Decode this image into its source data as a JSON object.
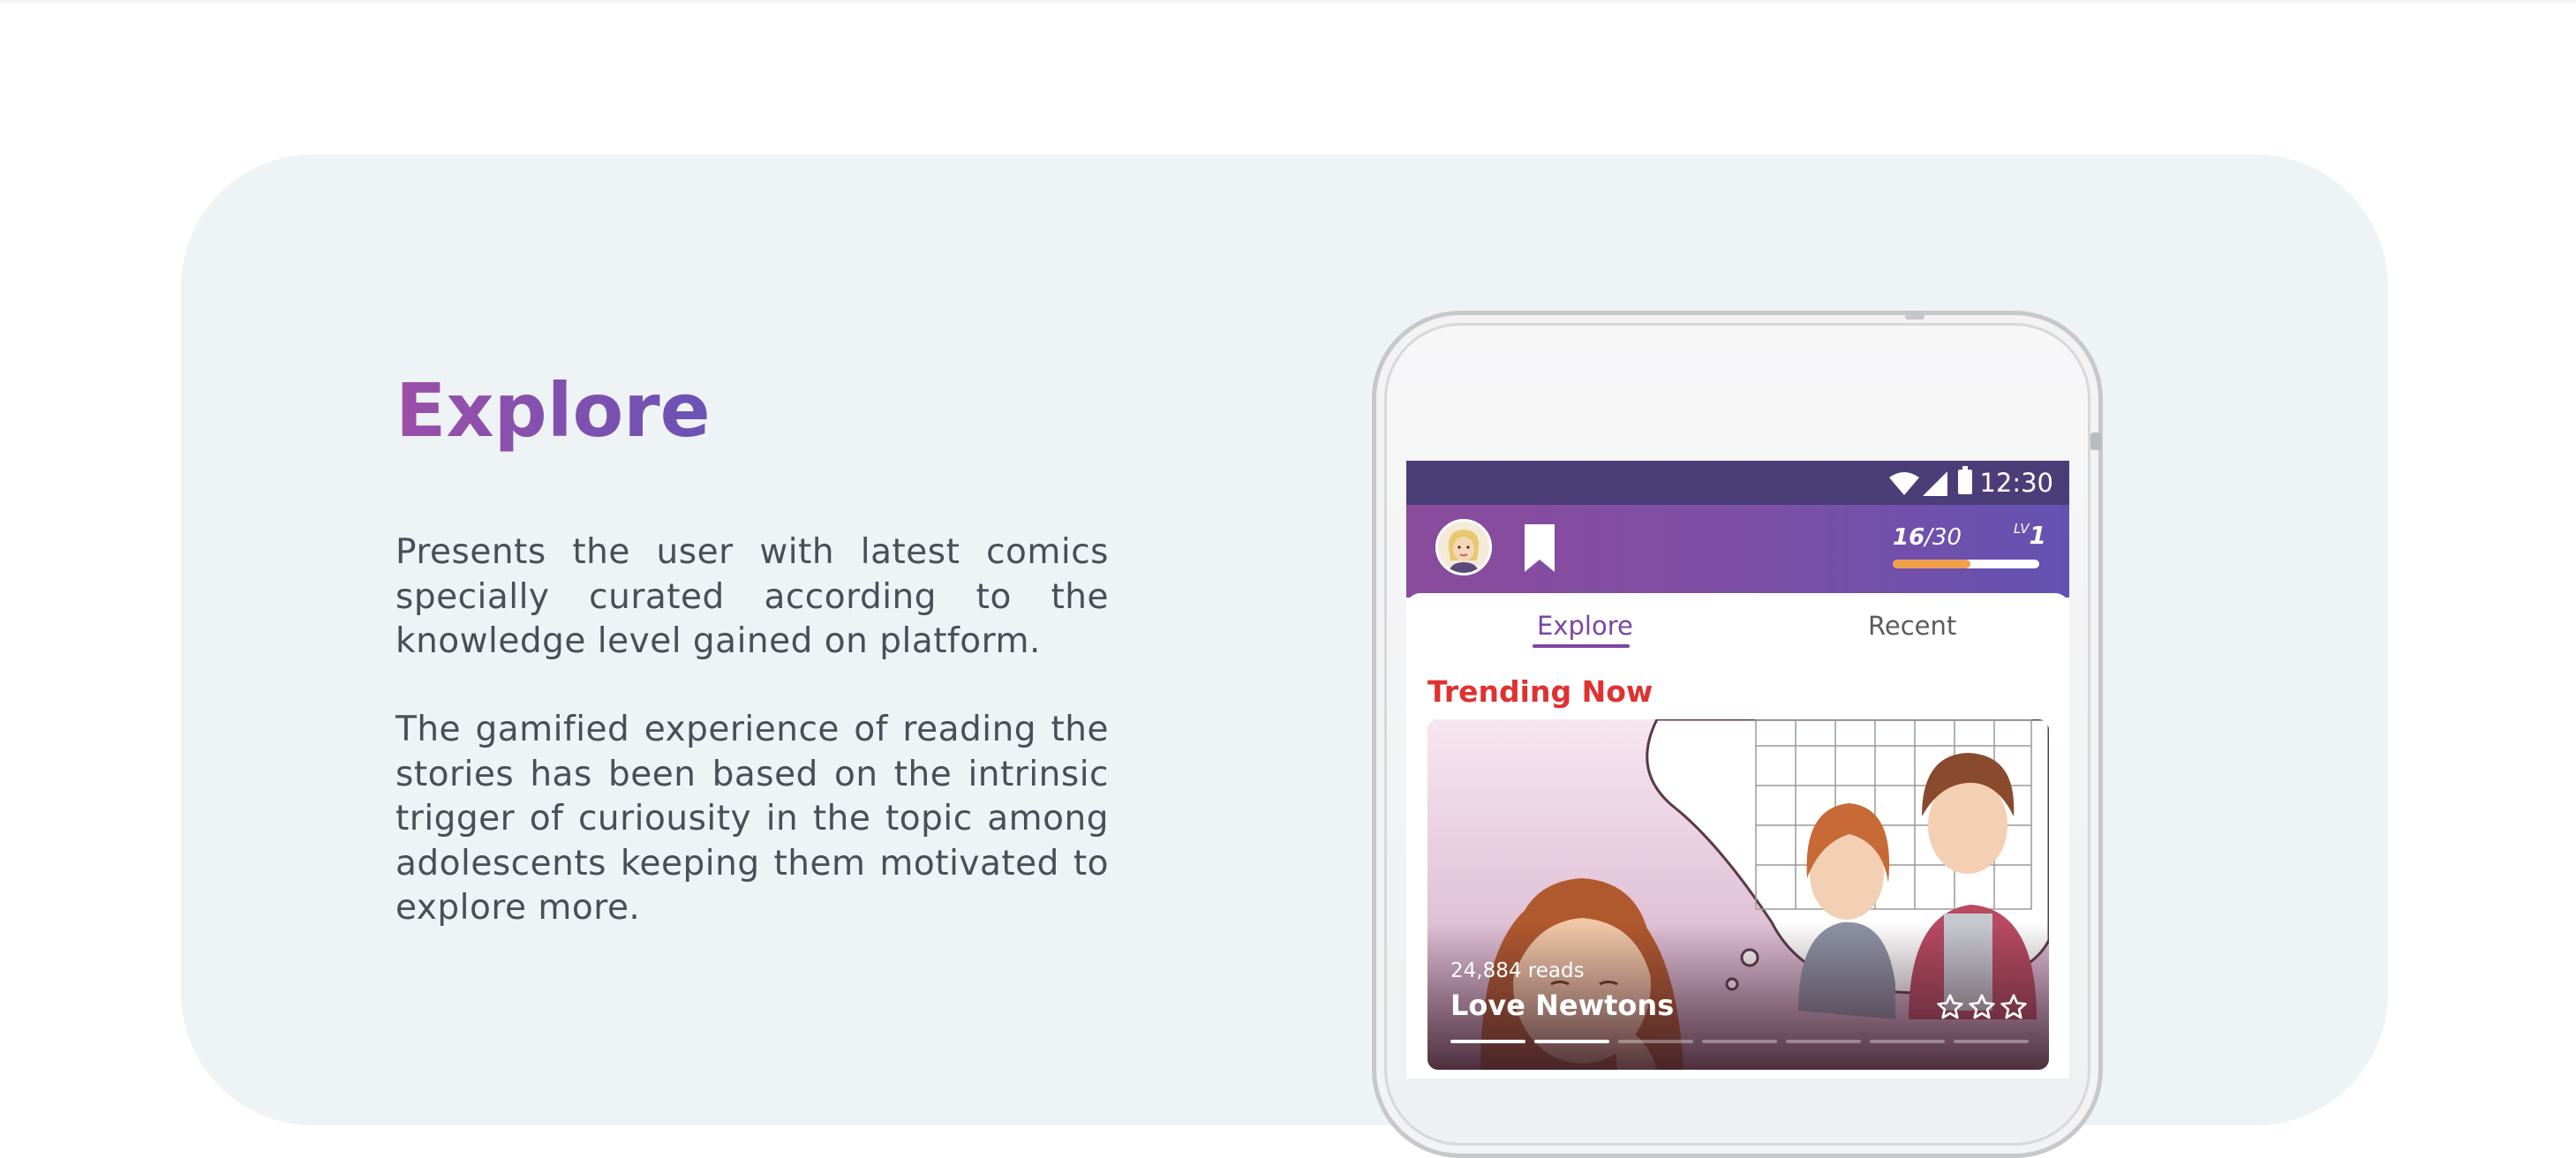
{
  "section": {
    "title": "Explore",
    "paragraph_1": "Presents the user with latest comics specially curated according to the knowledge level gained on platform.",
    "paragraph_2": "The gamified experience of reading the stories has been based on the intrinsic trigger of curiousity in the topic among adolescents keeping them motivated to explore more."
  },
  "phone": {
    "status_bar": {
      "time": "12:30",
      "icons": [
        "wifi-icon",
        "signal-icon",
        "battery-icon"
      ]
    },
    "app_bar": {
      "avatar": "avatar-icon",
      "bookmark": "bookmark-icon",
      "xp_current": "16",
      "xp_total": "/30",
      "xp_progress": 0.53,
      "level_label": "LV",
      "level_value": "1"
    },
    "tabs": [
      {
        "label": "Explore",
        "active": true
      },
      {
        "label": "Recent",
        "active": false
      }
    ],
    "trending_heading": "Trending Now",
    "featured": {
      "reads": "24,884 reads",
      "title": "Love Newtons",
      "rating_stars": 3,
      "carousel_total": 7,
      "carousel_active": [
        0,
        1
      ]
    },
    "colors": {
      "status_bar": "#4b3d78",
      "accent": "#7a46a3",
      "trending": "#e03131",
      "xp_fill": "#f0a04b"
    }
  }
}
